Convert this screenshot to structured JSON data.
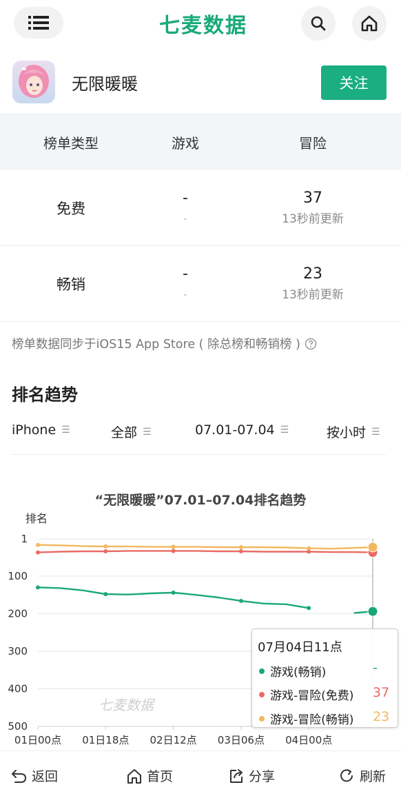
{
  "header": {
    "logo_text": "七麦数据",
    "menu_icon": "menu-icon",
    "search_icon": "search-icon",
    "home_icon": "home-icon"
  },
  "app": {
    "name": "无限暖暖",
    "follow_label": "关注"
  },
  "rank_table": {
    "headers": [
      "榜单类型",
      "游戏",
      "冒险"
    ],
    "rows": [
      {
        "type": "免费",
        "game": "-",
        "game_sub": "-",
        "adventure": "37",
        "adventure_sub": "13秒前更新"
      },
      {
        "type": "畅销",
        "game": "-",
        "game_sub": "-",
        "adventure": "23",
        "adventure_sub": "13秒前更新"
      }
    ]
  },
  "sync_note": "榜单数据同步于iOS15 App Store ( 除总榜和畅销榜 )",
  "trend": {
    "section_title": "排名趋势",
    "filters": {
      "device": "iPhone",
      "scope": "全部",
      "date_range": "07.01-07.04",
      "granularity": "按小时"
    }
  },
  "chart_data": {
    "type": "line",
    "title": "“无限暖暖”07.01–07.04排名趋势",
    "ylabel": "排名",
    "ylim": [
      1,
      500
    ],
    "y_inverted": true,
    "y_ticks": [
      "1",
      "100",
      "200",
      "300",
      "400",
      "500"
    ],
    "x_ticks": [
      "01日00点",
      "01日18点",
      "02日12点",
      "03日06点",
      "04日00点"
    ],
    "watermark": "七麦数据",
    "x": [
      0,
      6,
      12,
      18,
      24,
      30,
      36,
      42,
      48,
      54,
      60,
      66,
      72,
      78,
      84,
      89
    ],
    "series": [
      {
        "name": "游戏(畅销)",
        "color": "#1aa878",
        "values": [
          130,
          132,
          138,
          148,
          149,
          146,
          144,
          150,
          157,
          166,
          173,
          175,
          185,
          null,
          198,
          194
        ]
      },
      {
        "name": "游戏-冒险(免费)",
        "color": "#e96b64",
        "values": [
          37,
          35,
          34,
          34,
          33,
          33,
          33,
          33,
          34,
          34,
          35,
          35,
          35,
          36,
          36,
          37
        ]
      },
      {
        "name": "游戏-冒险(畅销)",
        "color": "#f3b85f",
        "values": [
          17,
          18,
          20,
          21,
          21,
          22,
          22,
          22,
          23,
          23,
          23,
          24,
          26,
          27,
          25,
          23
        ]
      }
    ],
    "grid": true,
    "tooltip": {
      "title": "07月04日11点",
      "items": [
        {
          "name": "游戏(畅销)",
          "value": "-",
          "color": "#1aa878"
        },
        {
          "name": "游戏-冒险(免费)",
          "value": "37",
          "color": "#e96b64"
        },
        {
          "name": "游戏-冒险(畅销)",
          "value": "23",
          "color": "#f3b85f"
        }
      ]
    }
  },
  "bottom_bar": {
    "back": "返回",
    "home": "首页",
    "share": "分享",
    "refresh": "刷新"
  },
  "colors": {
    "brand": "#1aae80",
    "header_bg": "#f3f6f9"
  }
}
